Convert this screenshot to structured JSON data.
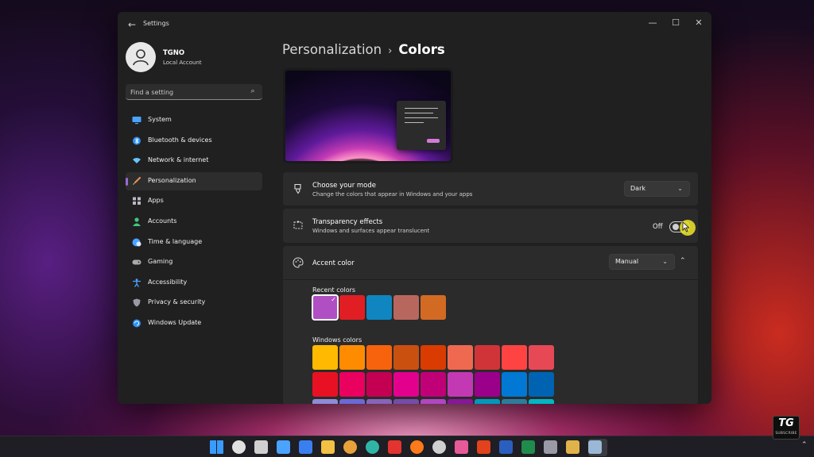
{
  "window": {
    "app_title": "Settings",
    "back_icon": "back-arrow-icon",
    "controls": [
      "minimize-icon",
      "maximize-icon",
      "close-icon"
    ]
  },
  "profile": {
    "name": "TGNO",
    "account_type": "Local Account",
    "icon": "person-icon"
  },
  "search": {
    "placeholder": "Find a setting",
    "icon": "search-icon"
  },
  "nav": [
    {
      "label": "System",
      "icon": "system-icon",
      "color": "#4aa3ff"
    },
    {
      "label": "Bluetooth & devices",
      "icon": "bluetooth-icon",
      "color": "#2f8fef"
    },
    {
      "label": "Network & internet",
      "icon": "wifi-icon",
      "color": "#69c3ff"
    },
    {
      "label": "Personalization",
      "icon": "brush-icon",
      "color": "#e8915a",
      "active": true
    },
    {
      "label": "Apps",
      "icon": "apps-icon",
      "color": "#b9b9c4"
    },
    {
      "label": "Accounts",
      "icon": "accounts-icon",
      "color": "#3fc77e"
    },
    {
      "label": "Time & language",
      "icon": "globe-clock-icon",
      "color": "#4aa3ff"
    },
    {
      "label": "Gaming",
      "icon": "gamepad-icon",
      "color": "#aaaaaa"
    },
    {
      "label": "Accessibility",
      "icon": "accessibility-icon",
      "color": "#4aa3ff"
    },
    {
      "label": "Privacy & security",
      "icon": "shield-icon",
      "color": "#9a9aa6"
    },
    {
      "label": "Windows Update",
      "icon": "update-icon",
      "color": "#2f8fef"
    }
  ],
  "breadcrumb": {
    "parent": "Personalization",
    "separator": "›",
    "current": "Colors"
  },
  "mode_card": {
    "title": "Choose your mode",
    "description": "Change the colors that appear in Windows and your apps",
    "value": "Dark",
    "icon": "paint-bucket-icon"
  },
  "transparency_card": {
    "title": "Transparency effects",
    "description": "Windows and surfaces appear translucent",
    "state_label": "Off",
    "icon": "transparency-icon"
  },
  "accent_card": {
    "title": "Accent color",
    "value": "Manual",
    "icon": "palette-icon",
    "recent_label": "Recent colors",
    "windows_label": "Windows colors",
    "recent_colors": [
      "#b04ec4",
      "#e21e25",
      "#0f86c0",
      "#b8675e",
      "#d26a24"
    ],
    "windows_colors": [
      [
        "#ffb900",
        "#ff8c00",
        "#f7630c",
        "#ca5010",
        "#da3b01",
        "#ef6950",
        "#d13438",
        "#ff4343",
        "#e74856"
      ],
      [
        "#e81123",
        "#ea005e",
        "#c30052",
        "#e3008c",
        "#bf0077",
        "#c239b3",
        "#9a0089",
        "#0078d4",
        "#0063b1"
      ],
      [
        "#8e8cd8",
        "#6b69d6",
        "#8764b8",
        "#744da9",
        "#b146c2",
        "#881798",
        "#0099bc",
        "#2d7d9a",
        "#00b7c3"
      ]
    ]
  },
  "taskbar": {
    "icons": [
      {
        "name": "start-icon",
        "color": "#3a9bff"
      },
      {
        "name": "search-icon",
        "color": "#e0e0e0"
      },
      {
        "name": "task-view-icon",
        "color": "#d0d0d0"
      },
      {
        "name": "widgets-icon",
        "color": "#4aa3ff"
      },
      {
        "name": "store-icon",
        "color": "#3a7ff0"
      },
      {
        "name": "file-explorer-icon",
        "color": "#f2c045"
      },
      {
        "name": "chrome-icon",
        "color": "#e8a13a"
      },
      {
        "name": "edge-icon",
        "color": "#2fb5a8"
      },
      {
        "name": "vivaldi-icon",
        "color": "#e4342f"
      },
      {
        "name": "firefox-icon",
        "color": "#ff7a1a"
      },
      {
        "name": "obs-icon",
        "color": "#cfcfcf"
      },
      {
        "name": "photos-icon",
        "color": "#e75a9a"
      },
      {
        "name": "office-icon",
        "color": "#e2421c"
      },
      {
        "name": "word-icon",
        "color": "#2b5fbf"
      },
      {
        "name": "excel-icon",
        "color": "#1f8b4c"
      },
      {
        "name": "camera-icon",
        "color": "#9a9aa6"
      },
      {
        "name": "app-icon",
        "color": "#e0b34a"
      },
      {
        "name": "settings-icon",
        "color": "#9ab8d6",
        "active": true
      }
    ],
    "tray_icon": "chevron-up-icon"
  },
  "watermark": {
    "main": "TG",
    "sub": "SUBSCRIBE"
  }
}
